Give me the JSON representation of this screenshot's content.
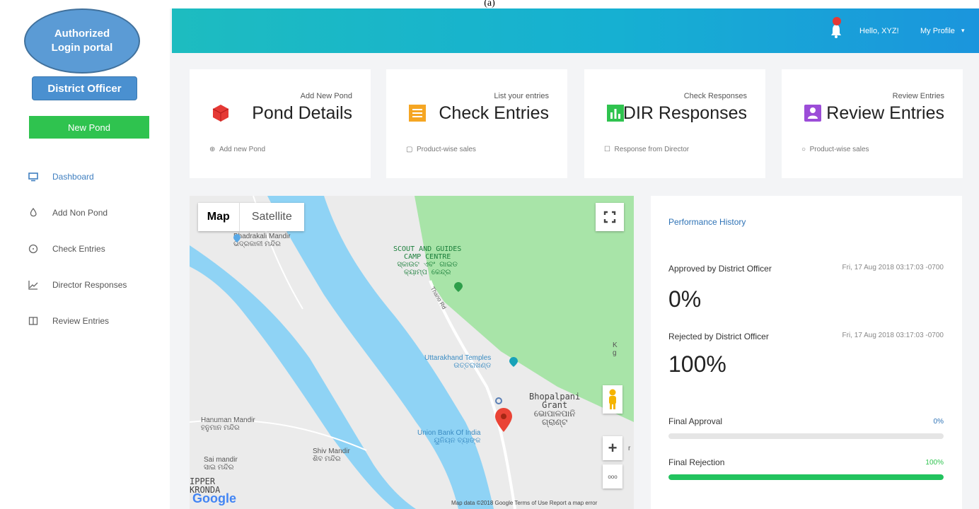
{
  "figure_label": "(a)",
  "sidebar": {
    "brand_line1": "Authorized",
    "brand_line2": "Login portal",
    "role_label": "District Officer",
    "new_pond_label": "New Pond",
    "items": [
      {
        "label": "Dashboard",
        "icon": "monitor-icon",
        "active": true
      },
      {
        "label": "Add Non Pond",
        "icon": "drop-icon"
      },
      {
        "label": "Check Entries",
        "icon": "clock-icon"
      },
      {
        "label": "Director Responses",
        "icon": "chart-icon"
      },
      {
        "label": "Review Entries",
        "icon": "book-icon"
      }
    ]
  },
  "header": {
    "greeting": "Hello, XYZ!",
    "profile_label": "My Profile",
    "caret": "▾",
    "accent_gradient": [
      "#1dbcc0",
      "#1b95dd"
    ]
  },
  "cards": [
    {
      "subtitle": "Add New Pond",
      "title": "Pond Details",
      "footer": "Add new Pond",
      "footer_icon": "⊕",
      "icon": "cube-icon",
      "color": "#e53935"
    },
    {
      "subtitle": "List your entries",
      "title": "Check Entries",
      "footer": "Product-wise sales",
      "footer_icon": "▢",
      "icon": "list-icon",
      "color": "#f5a623"
    },
    {
      "subtitle": "Check Responses",
      "title": "DIR Responses",
      "footer": "Response from Director",
      "footer_icon": "☐",
      "icon": "bar-chart-icon",
      "color": "#2fc34f"
    },
    {
      "subtitle": "Review Entries",
      "title": "Review Entries",
      "footer": "Product-wise sales",
      "footer_icon": "○",
      "icon": "user-badge-icon",
      "color": "#9c4dd8"
    }
  ],
  "map": {
    "map_label": "Map",
    "satellite_label": "Satellite",
    "places": {
      "bhadrakali": "Bhadrakali Mandir",
      "bhadrakali_sub": "ଭଦ୍ରକାଳୀ ମନ୍ଦିର",
      "scout_l1": "SCOUT AND GUIDES",
      "scout_l2": "CAMP CENTRE",
      "scout_l3": "ସ୍କାଉଟ ଏବଂ ଗାଇଡ",
      "scout_l4": "କ୍ୟାମ୍ପ କେନ୍ଦ୍ର",
      "uttarakhand": "Uttarakhand Temples",
      "uttarakhand_sub": "ଉତ୍ତରାଖଣ୍ଡ",
      "bhopalpani_l1": "Bhopalpani",
      "bhopalpani_l2": "Grant",
      "bhopalpani_l3": "ଭୋପାଳପାନି",
      "bhopalpani_l4": "ଗ୍ରାଣ୍ଟ",
      "hanuman": "Hanuman Mandir",
      "hanuman_sub": "ହନୁମାନ ମନ୍ଦିର",
      "sai": "Sai mandir",
      "sai_sub": "ସାଇ ମନ୍ଦିର",
      "shiv": "Shiv Mandir",
      "shiv_sub": "ଶିବ ମନ୍ଦିର",
      "union": "Union Bank Of India",
      "union_sub": "ୟୁନିୟନ ବ୍ୟାଙ୍କ",
      "ripper_l1": "IPPER",
      "ripper_l2": "KRONDA",
      "road": "Thano Rd",
      "edge_k": "K",
      "edge_g": "g",
      "edge_r": "r"
    },
    "attribution": "Map data ©2018 Google   Terms of Use   Report a map error",
    "google": "Google",
    "zoom_in": "+",
    "zoom_out": "ooo"
  },
  "performance": {
    "title": "Performance History",
    "approved_label": "Approved by District Officer",
    "approved_date": "Fri, 17 Aug 2018 03:17:03 -0700",
    "approved_value": "0%",
    "rejected_label": "Rejected by District Officer",
    "rejected_date": "Fri, 17 Aug 2018 03:17:03 -0700",
    "rejected_value": "100%",
    "final_approval_label": "Final Approval",
    "final_approval_value": "0%",
    "final_approval_fraction": 0,
    "final_rejection_label": "Final Rejection",
    "final_rejection_value": "100%",
    "final_rejection_fraction": 1
  }
}
